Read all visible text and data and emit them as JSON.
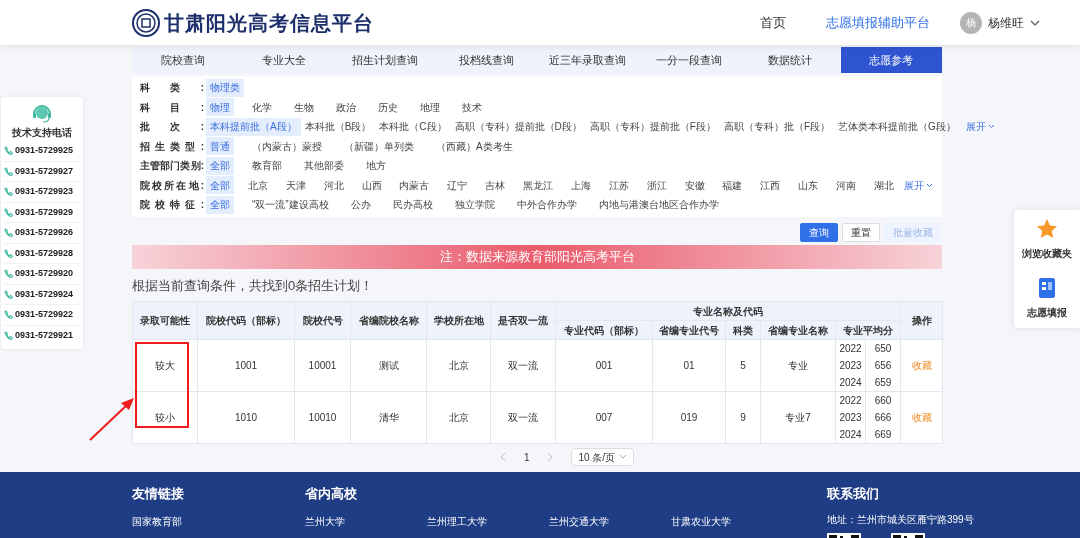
{
  "header": {
    "logo_text": "甘肃阳光高考信息平台",
    "nav": [
      {
        "label": "首页",
        "selected": false
      },
      {
        "label": "志愿填报辅助平台",
        "selected": true
      }
    ],
    "user": {
      "avatar": "杨",
      "name": "杨维旺"
    }
  },
  "tabs": [
    {
      "label": "院校查询",
      "selected": false
    },
    {
      "label": "专业大全",
      "selected": false
    },
    {
      "label": "招生计划查询",
      "selected": false
    },
    {
      "label": "投档线查询",
      "selected": false
    },
    {
      "label": "近三年录取查询",
      "selected": false
    },
    {
      "label": "一分一段查询",
      "selected": false
    },
    {
      "label": "数据统计",
      "selected": false
    },
    {
      "label": "志愿参考",
      "selected": true
    }
  ],
  "filters": [
    {
      "label": "科类:",
      "spread": false,
      "options": [
        {
          "label": "物理类",
          "selected": true
        }
      ]
    },
    {
      "label": "科目:",
      "spread": false,
      "options": [
        {
          "label": "物理",
          "selected": true
        },
        {
          "label": "化学",
          "selected": false
        },
        {
          "label": "生物",
          "selected": false
        },
        {
          "label": "政治",
          "selected": false
        },
        {
          "label": "历史",
          "selected": false
        },
        {
          "label": "地理",
          "selected": false
        },
        {
          "label": "技术",
          "selected": false
        }
      ]
    },
    {
      "label": "批次:",
      "spread": true,
      "expand": "展开",
      "options": [
        {
          "label": "本科提前批（A段）",
          "selected": true
        },
        {
          "label": "本科批（B段）",
          "selected": false
        },
        {
          "label": "本科批（C段）",
          "selected": false
        },
        {
          "label": "高职（专科）提前批（D段）",
          "selected": false
        },
        {
          "label": "高职（专科）提前批（F段）",
          "selected": false
        },
        {
          "label": "高职（专科）批（F段）",
          "selected": false
        },
        {
          "label": "艺体类本科提前批（G段）",
          "selected": false
        }
      ]
    },
    {
      "label": "招生类型:",
      "spread": false,
      "options": [
        {
          "label": "普通",
          "selected": true
        },
        {
          "label": "（内蒙古）蒙授",
          "selected": false
        },
        {
          "label": "（新疆）单列类",
          "selected": false
        },
        {
          "label": "（西藏）A类考生",
          "selected": false
        }
      ]
    },
    {
      "label": "主管部门类别:",
      "spread": false,
      "options": [
        {
          "label": "全部",
          "selected": true
        },
        {
          "label": "教育部",
          "selected": false
        },
        {
          "label": "其他部委",
          "selected": false
        },
        {
          "label": "地方",
          "selected": false
        }
      ]
    },
    {
      "label": "院校所在地:",
      "spread": true,
      "expand": "展开",
      "options": [
        {
          "label": "全部",
          "selected": true
        },
        {
          "label": "北京",
          "selected": false
        },
        {
          "label": "天津",
          "selected": false
        },
        {
          "label": "河北",
          "selected": false
        },
        {
          "label": "山西",
          "selected": false
        },
        {
          "label": "内蒙古",
          "selected": false
        },
        {
          "label": "辽宁",
          "selected": false
        },
        {
          "label": "吉林",
          "selected": false
        },
        {
          "label": "黑龙江",
          "selected": false
        },
        {
          "label": "上海",
          "selected": false
        },
        {
          "label": "江苏",
          "selected": false
        },
        {
          "label": "浙江",
          "selected": false
        },
        {
          "label": "安徽",
          "selected": false
        },
        {
          "label": "福建",
          "selected": false
        },
        {
          "label": "江西",
          "selected": false
        },
        {
          "label": "山东",
          "selected": false
        },
        {
          "label": "河南",
          "selected": false
        },
        {
          "label": "湖北",
          "selected": false
        }
      ]
    },
    {
      "label": "院校特征:",
      "spread": false,
      "options": [
        {
          "label": "全部",
          "selected": true
        },
        {
          "label": "“双一流”建设高校",
          "selected": false
        },
        {
          "label": "公办",
          "selected": false
        },
        {
          "label": "民办高校",
          "selected": false
        },
        {
          "label": "独立学院",
          "selected": false
        },
        {
          "label": "中外合作办学",
          "selected": false
        },
        {
          "label": "内地与港澳台地区合作办学",
          "selected": false
        }
      ]
    }
  ],
  "buttons": [
    {
      "label": "查询",
      "kind": "primary"
    },
    {
      "label": "重置",
      "kind": "default"
    },
    {
      "label": "批量收藏",
      "kind": "disabled"
    }
  ],
  "notice": "注：数据来源教育部阳光高考平台",
  "result_text": "根据当前查询条件，共找到0条招生计划！",
  "table": {
    "columns": [
      {
        "label": "录取可能性"
      },
      {
        "label": "院校代码（部标）"
      },
      {
        "label": "院校代号"
      },
      {
        "label": "省编院校名称"
      },
      {
        "label": "学校所在地"
      },
      {
        "label": "是否双一流"
      },
      {
        "label": "专业名称及代码",
        "children": [
          {
            "label": "专业代码（部标）"
          },
          {
            "label": "省编专业代号"
          },
          {
            "label": "科类"
          },
          {
            "label": "省编专业名称"
          },
          {
            "label": "专业平均分",
            "kind": "scores"
          }
        ]
      },
      {
        "label": "操作"
      }
    ],
    "rows": [
      {
        "likelihood": "较大",
        "school_code": "1001",
        "school_no": "10001",
        "school_name": "测试",
        "location": "北京",
        "double_first": "双一流",
        "major_code": "001",
        "major_no": "01",
        "category": "5",
        "major_name": "专业",
        "scores": [
          {
            "year": "2022",
            "score": "650"
          },
          {
            "year": "2023",
            "score": "656"
          },
          {
            "year": "2024",
            "score": "659"
          }
        ],
        "action": "收藏"
      },
      {
        "likelihood": "较小",
        "school_code": "1010",
        "school_no": "10010",
        "school_name": "清华",
        "location": "北京",
        "double_first": "双一流",
        "major_code": "007",
        "major_no": "019",
        "category": "9",
        "major_name": "专业7",
        "scores": [
          {
            "year": "2022",
            "score": "660"
          },
          {
            "year": "2023",
            "score": "666"
          },
          {
            "year": "2024",
            "score": "669"
          }
        ],
        "action": "收藏"
      }
    ]
  },
  "pagination": {
    "page": "1",
    "page_size": "10 条/页"
  },
  "sidebar": {
    "title": "技术支持电话",
    "phones": [
      "0931-5729925",
      "0931-5729927",
      "0931-5729923",
      "0931-5729929",
      "0931-5729926",
      "0931-5729928",
      "0931-5729920",
      "0931-5729924",
      "0931-5729922",
      "0931-5729921"
    ]
  },
  "right_panel": [
    {
      "label": "浏览收藏夹",
      "kind": "star"
    },
    {
      "label": "志愿填报",
      "kind": "form"
    }
  ],
  "footer": {
    "sections": [
      {
        "title": "友情链接",
        "links": [
          "国家教育部"
        ]
      },
      {
        "title": "省内高校",
        "links": [
          "兰州大学",
          "兰州理工大学",
          "兰州交通大学",
          "甘肃农业大学"
        ]
      },
      {
        "title": "联系我们",
        "address": "地址：兰州市城关区雁宁路399号"
      }
    ]
  }
}
